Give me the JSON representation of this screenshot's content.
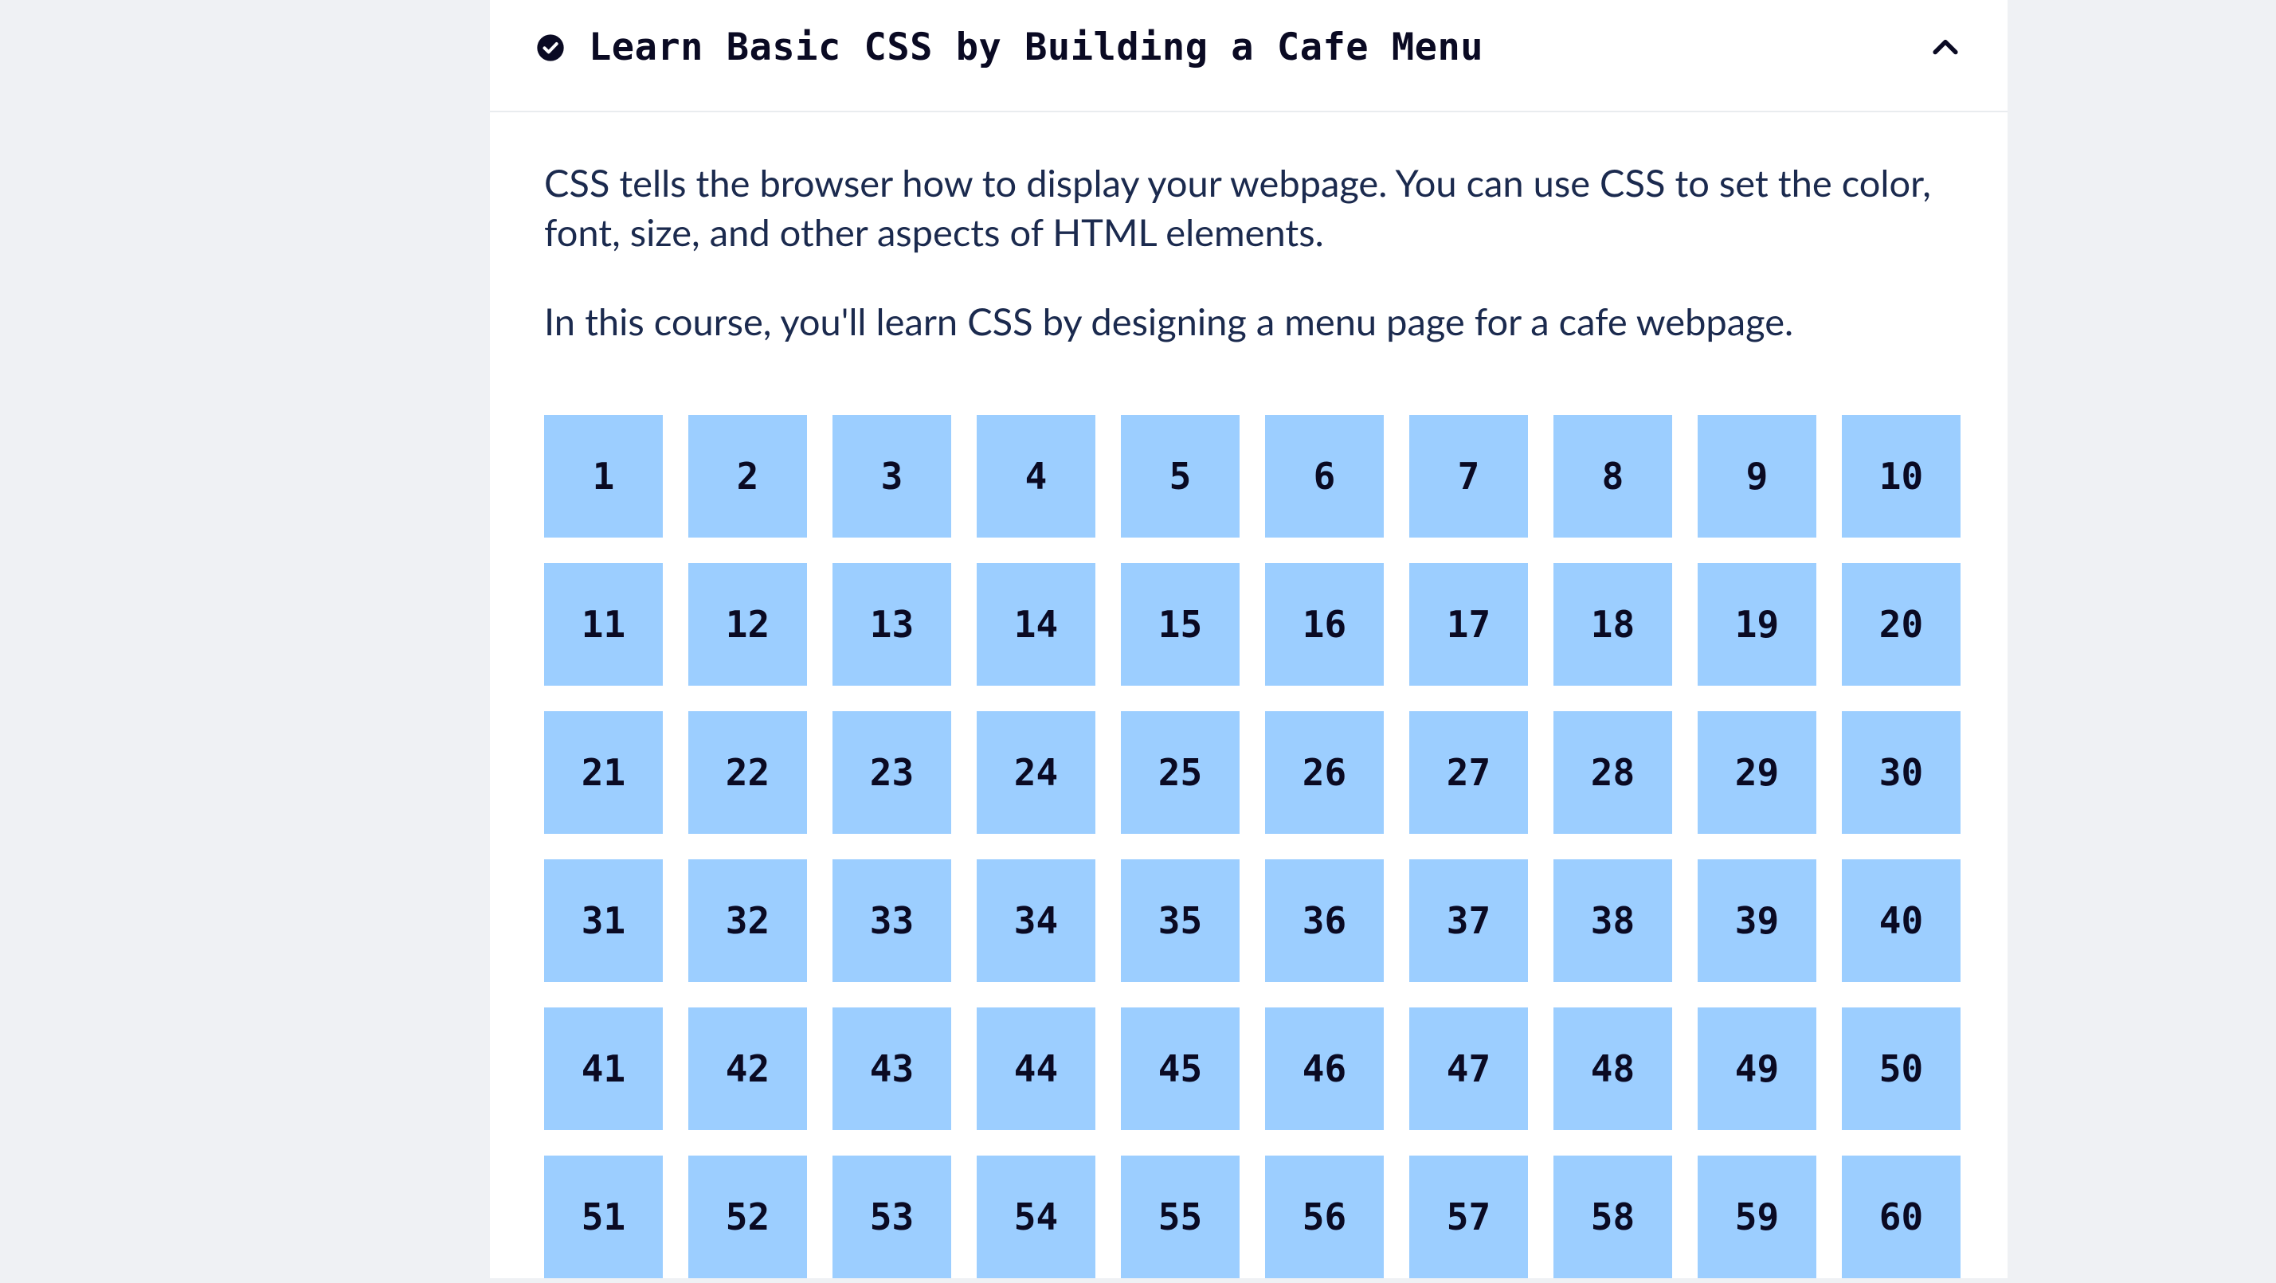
{
  "course": {
    "title": "Learn Basic CSS by Building a Cafe Menu",
    "completed": true,
    "expanded": true,
    "description": [
      "CSS tells the browser how to display your webpage. You can use CSS to set the color, font, size, and other aspects of HTML elements.",
      "In this course, you'll learn CSS by designing a menu page for a cafe webpage."
    ],
    "steps": [
      1,
      2,
      3,
      4,
      5,
      6,
      7,
      8,
      9,
      10,
      11,
      12,
      13,
      14,
      15,
      16,
      17,
      18,
      19,
      20,
      21,
      22,
      23,
      24,
      25,
      26,
      27,
      28,
      29,
      30,
      31,
      32,
      33,
      34,
      35,
      36,
      37,
      38,
      39,
      40,
      41,
      42,
      43,
      44,
      45,
      46,
      47,
      48,
      49,
      50,
      51,
      52,
      53,
      54,
      55,
      56,
      57,
      58,
      59,
      60
    ]
  },
  "colors": {
    "stepBg": "#9cceff",
    "pageBg": "#eff1f4",
    "text": "#1b2a4e"
  },
  "icons": {
    "check": "check-circle-icon",
    "chevron": "chevron-up-icon"
  }
}
